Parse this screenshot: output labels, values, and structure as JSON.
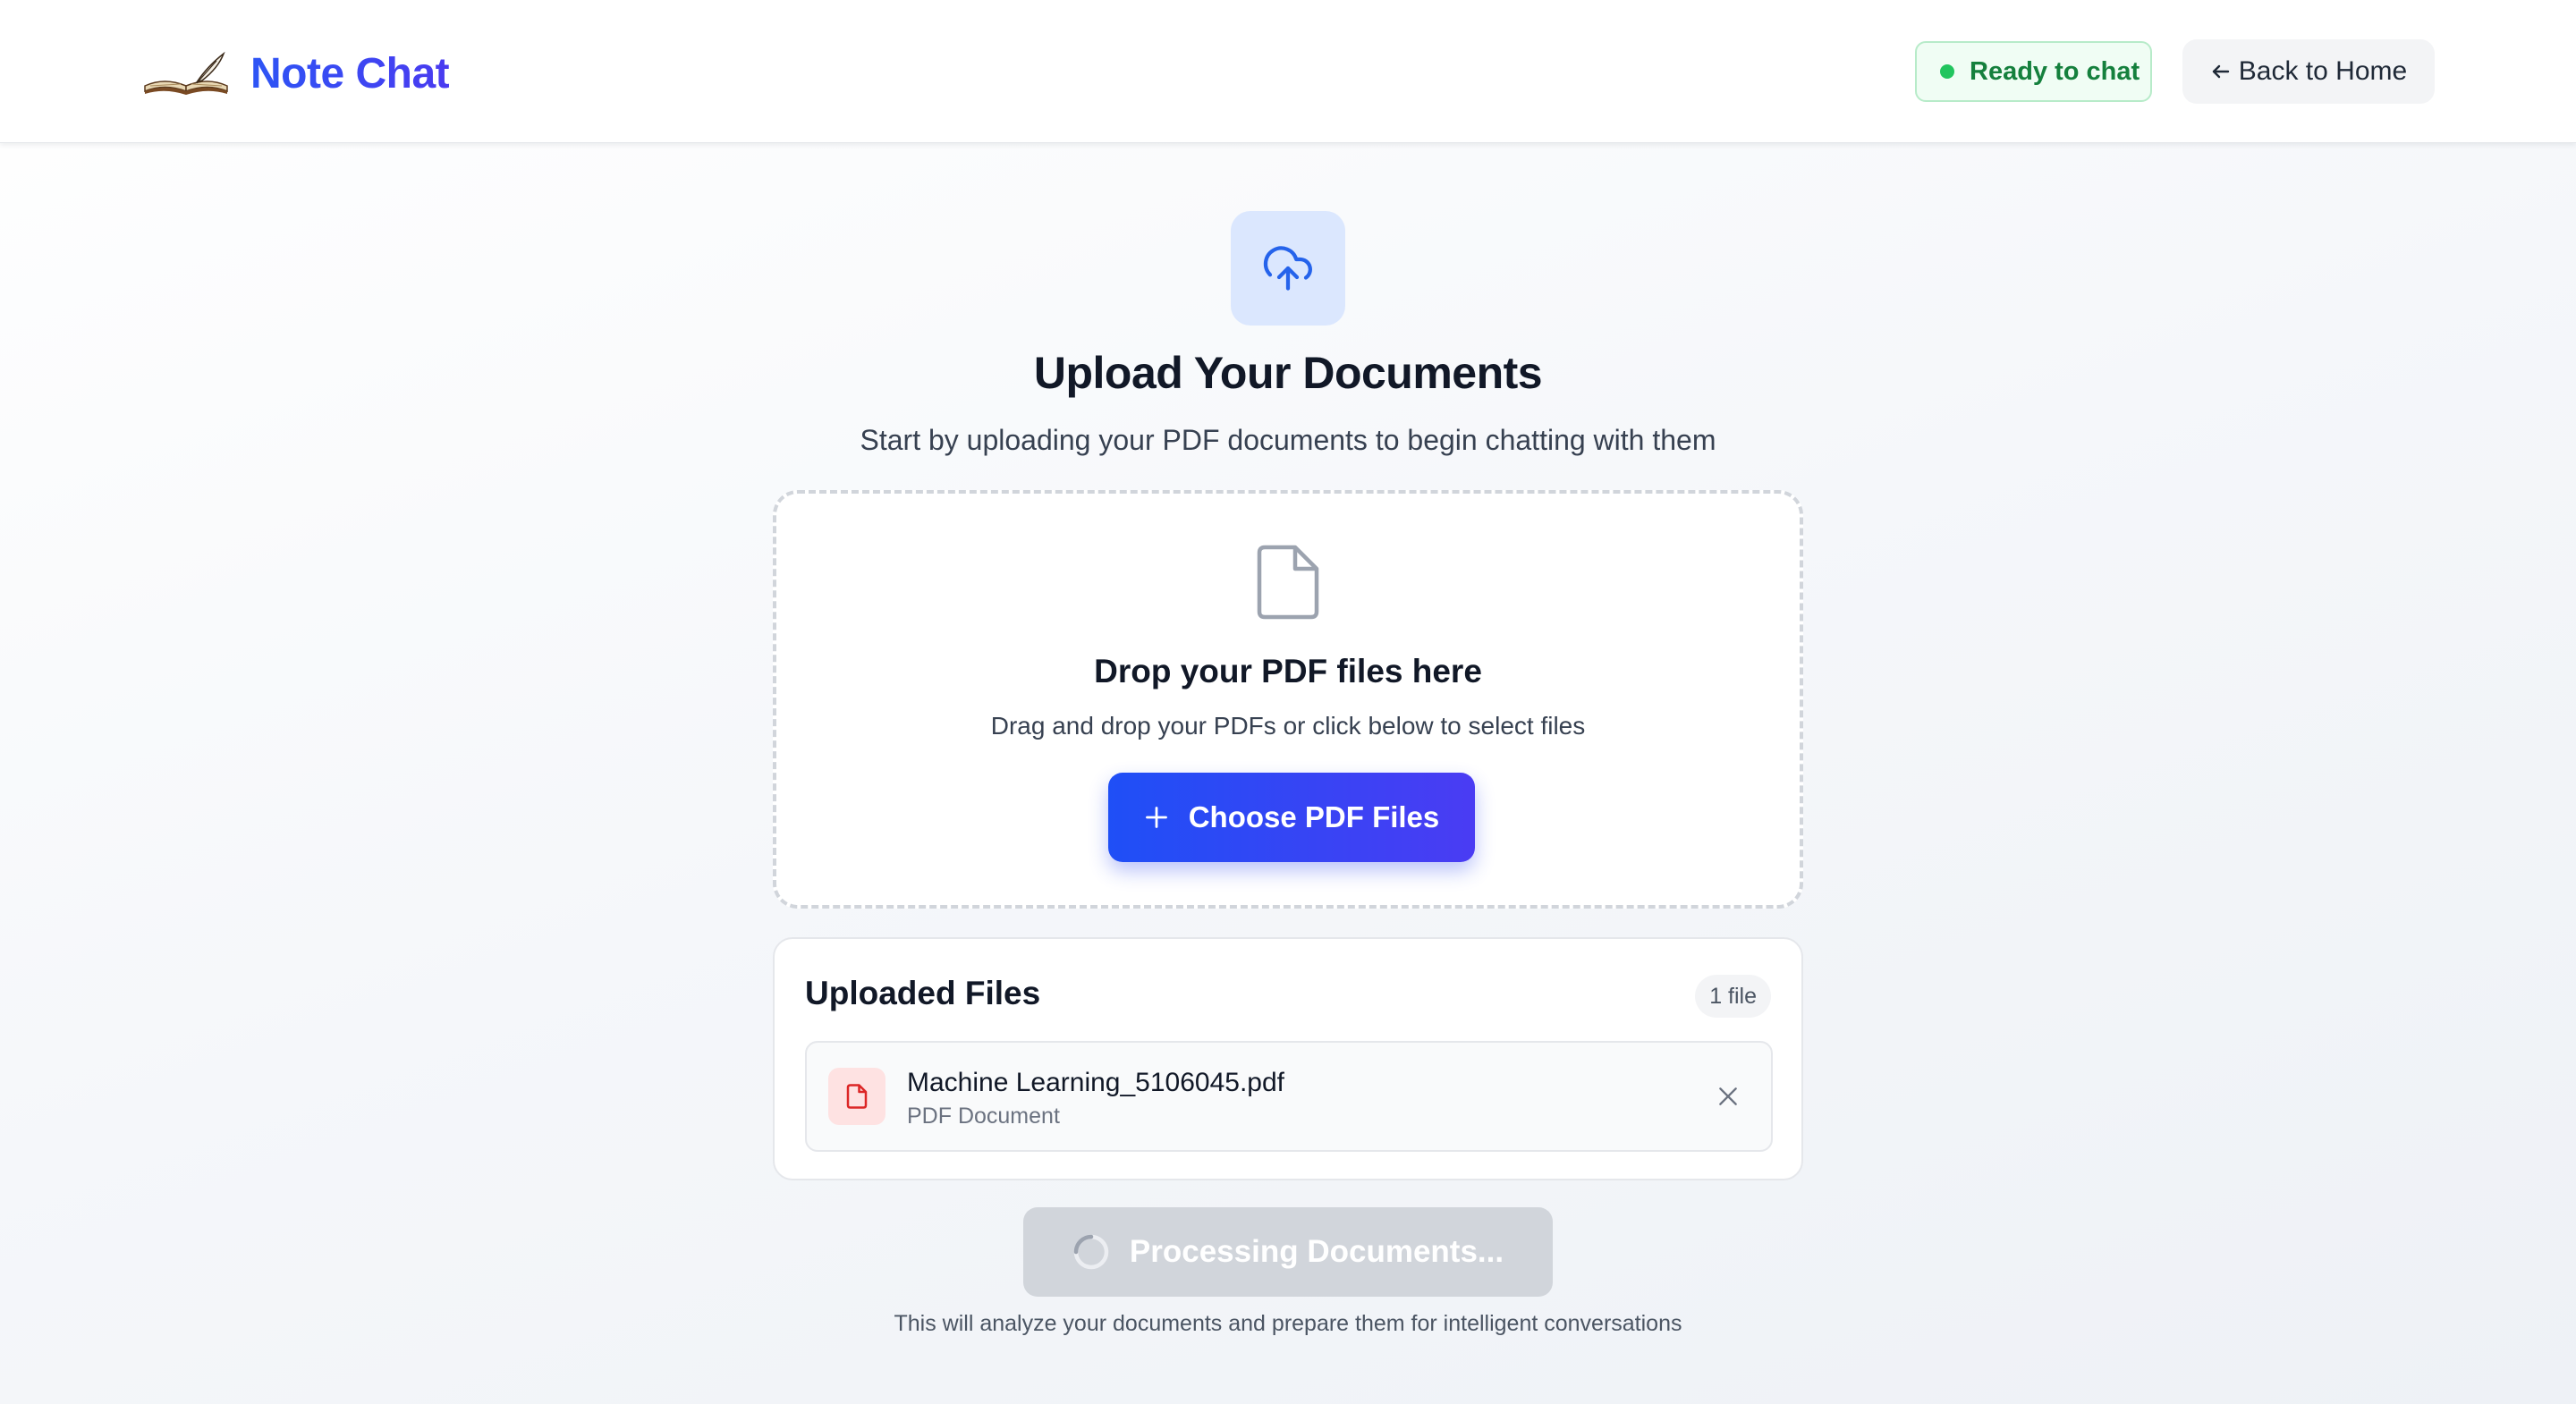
{
  "header": {
    "app_title": "Note Chat",
    "logo_icon": "open-book-with-quill-icon",
    "status_text": "Ready to chat",
    "status_color": "#22c55e",
    "back_label": "Back to Home"
  },
  "main": {
    "upload_icon": "cloud-upload-icon",
    "title": "Upload Your Documents",
    "subtitle": "Start by uploading your PDF documents to begin chatting with them"
  },
  "dropzone": {
    "icon": "document-icon",
    "title": "Drop your PDF files here",
    "hint": "Drag and drop your PDFs or click below to select files",
    "button_label": "Choose PDF Files"
  },
  "uploaded": {
    "title": "Uploaded Files",
    "count_label": "1 file",
    "files": [
      {
        "name": "Machine Learning_5106045.pdf",
        "type": "PDF Document",
        "icon": "pdf-file-icon"
      }
    ]
  },
  "process": {
    "button_label": "Processing Documents...",
    "note": "This will analyze your documents and prepare them for intelligent conversations"
  },
  "colors": {
    "accent": "#2f4ff5",
    "accent_gradient_end": "#4a3cf3",
    "status_bg": "#f0fdf4",
    "status_text": "#15803d",
    "pdf_icon": "#dc2626",
    "disabled_button": "#d1d5db"
  }
}
